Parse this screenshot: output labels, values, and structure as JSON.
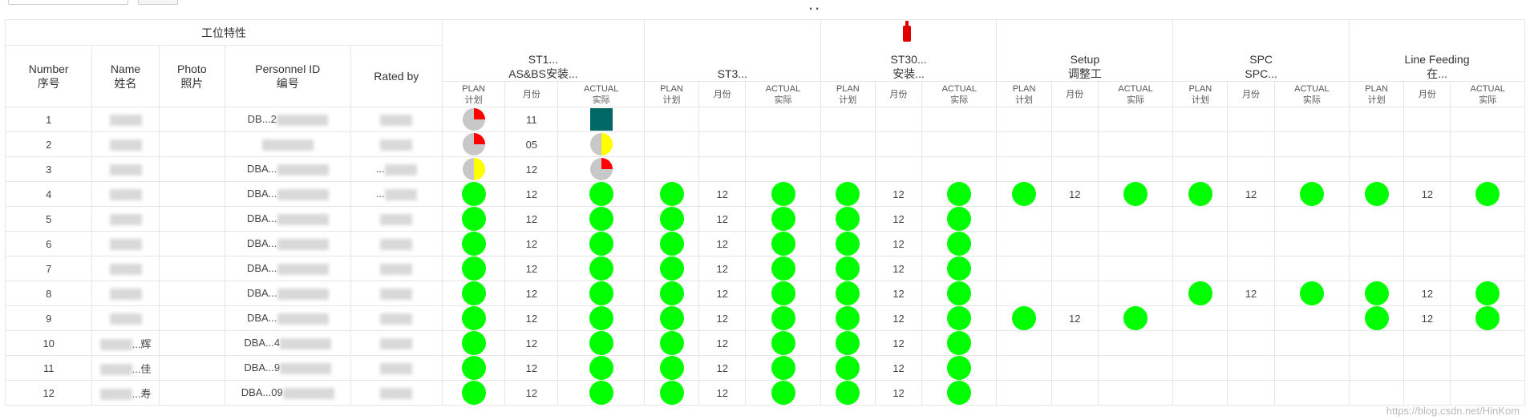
{
  "page": {
    "title": ".."
  },
  "headers": {
    "group_label": "工位特性",
    "number": "Number\n序号",
    "name": "Name\n姓名",
    "photo": "Photo\n照片",
    "personnel_id": "Personnel ID\n编号",
    "rated_by": "Rated by",
    "stations": [
      "ST1...\nAS&BS安装...",
      "ST3...",
      "ST30...\n安装...",
      "Setup\n调整工",
      "SPC\nSPC...",
      "Line Feeding\n在..."
    ],
    "sub_plan": "PLAN\n计划",
    "sub_month": "月份",
    "sub_actual": "ACTUAL\n实际"
  },
  "colors": {
    "green": "#00ff00",
    "red": "#ff0000",
    "yellow": "#ffff00",
    "grey": "#c8c8c8",
    "teal": "#006666"
  },
  "rows": [
    {
      "number": "1",
      "name": "",
      "id": "DB...2",
      "rated_by": "",
      "cells": [
        {
          "plan": "pie-quarter-red",
          "month": "11",
          "actual": "square-teal"
        },
        null,
        null,
        null,
        null,
        null
      ]
    },
    {
      "number": "2",
      "name": "",
      "id": "",
      "rated_by": "",
      "cells": [
        {
          "plan": "pie-quarter-red",
          "month": "05",
          "actual": "pie-half-yellow"
        },
        null,
        null,
        null,
        null,
        null
      ]
    },
    {
      "number": "3",
      "name": "",
      "id": "DBA...",
      "rated_by": "...",
      "cells": [
        {
          "plan": "pie-half-yellow",
          "month": "12",
          "actual": "pie-quarter-red"
        },
        null,
        null,
        null,
        null,
        null
      ]
    },
    {
      "number": "4",
      "name": "",
      "id": "DBA...",
      "rated_by": "...",
      "cells": [
        {
          "plan": "green",
          "month": "12",
          "actual": "green"
        },
        {
          "plan": "green",
          "month": "12",
          "actual": "green"
        },
        {
          "plan": "green",
          "month": "12",
          "actual": "green"
        },
        {
          "plan": "green",
          "month": "12",
          "actual": "green"
        },
        {
          "plan": "green",
          "month": "12",
          "actual": "green"
        },
        {
          "plan": "green",
          "month": "12",
          "actual": "green"
        }
      ]
    },
    {
      "number": "5",
      "name": "",
      "id": "DBA...",
      "rated_by": "",
      "cells": [
        {
          "plan": "green",
          "month": "12",
          "actual": "green"
        },
        {
          "plan": "green",
          "month": "12",
          "actual": "green"
        },
        {
          "plan": "green",
          "month": "12",
          "actual": "green"
        },
        null,
        null,
        null
      ]
    },
    {
      "number": "6",
      "name": "",
      "id": "DBA...",
      "rated_by": "",
      "cells": [
        {
          "plan": "green",
          "month": "12",
          "actual": "green"
        },
        {
          "plan": "green",
          "month": "12",
          "actual": "green"
        },
        {
          "plan": "green",
          "month": "12",
          "actual": "green"
        },
        null,
        null,
        null
      ]
    },
    {
      "number": "7",
      "name": "",
      "id": "DBA...",
      "rated_by": "",
      "cells": [
        {
          "plan": "green",
          "month": "12",
          "actual": "green"
        },
        {
          "plan": "green",
          "month": "12",
          "actual": "green"
        },
        {
          "plan": "green",
          "month": "12",
          "actual": "green"
        },
        null,
        null,
        null
      ]
    },
    {
      "number": "8",
      "name": "",
      "id": "DBA...",
      "rated_by": "",
      "cells": [
        {
          "plan": "green",
          "month": "12",
          "actual": "green"
        },
        {
          "plan": "green",
          "month": "12",
          "actual": "green"
        },
        {
          "plan": "green",
          "month": "12",
          "actual": "green"
        },
        null,
        {
          "plan": "green",
          "month": "12",
          "actual": "green"
        },
        {
          "plan": "green",
          "month": "12",
          "actual": "green"
        }
      ]
    },
    {
      "number": "9",
      "name": "",
      "id": "DBA...",
      "rated_by": "",
      "cells": [
        {
          "plan": "green",
          "month": "12",
          "actual": "green"
        },
        {
          "plan": "green",
          "month": "12",
          "actual": "green"
        },
        {
          "plan": "green",
          "month": "12",
          "actual": "green"
        },
        {
          "plan": "green",
          "month": "12",
          "actual": "green"
        },
        null,
        {
          "plan": "green",
          "month": "12",
          "actual": "green"
        }
      ]
    },
    {
      "number": "10",
      "name": "...辉",
      "id": "DBA...4",
      "rated_by": "",
      "cells": [
        {
          "plan": "green",
          "month": "12",
          "actual": "green"
        },
        {
          "plan": "green",
          "month": "12",
          "actual": "green"
        },
        {
          "plan": "green",
          "month": "12",
          "actual": "green"
        },
        null,
        null,
        null
      ]
    },
    {
      "number": "11",
      "name": "...佳",
      "id": "DBA...9",
      "rated_by": "",
      "cells": [
        {
          "plan": "green",
          "month": "12",
          "actual": "green"
        },
        {
          "plan": "green",
          "month": "12",
          "actual": "green"
        },
        {
          "plan": "green",
          "month": "12",
          "actual": "green"
        },
        null,
        null,
        null
      ]
    },
    {
      "number": "12",
      "name": "...寿",
      "id": "DBA...09",
      "rated_by": "",
      "cells": [
        {
          "plan": "green",
          "month": "12",
          "actual": "green"
        },
        {
          "plan": "green",
          "month": "12",
          "actual": "green"
        },
        {
          "plan": "green",
          "month": "12",
          "actual": "green"
        },
        null,
        null,
        null
      ]
    }
  ],
  "watermark": "https://blog.csdn.net/HinKom"
}
